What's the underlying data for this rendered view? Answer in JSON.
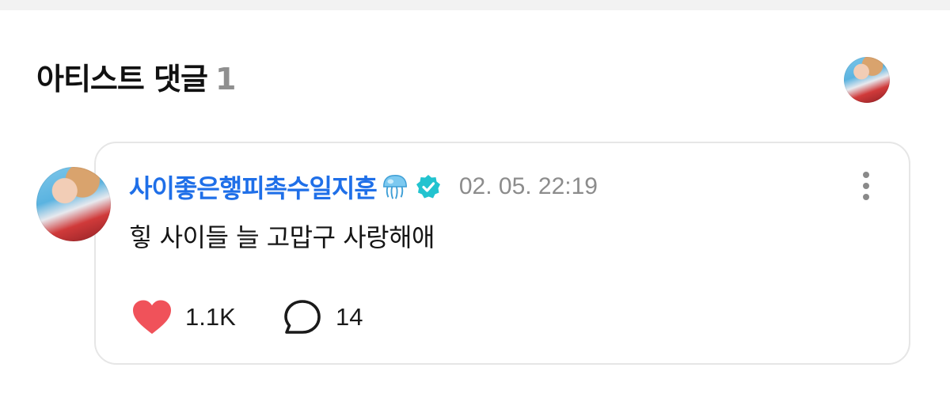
{
  "header": {
    "title": "아티스트 댓글",
    "count": "1",
    "avatar_icon": "artist-avatar"
  },
  "comment": {
    "author": "사이좋은햏피촉수일지훈",
    "author_emoji": "jellyfish-emoji",
    "verified_icon": "verified-badge-icon",
    "timestamp": "02. 05. 22:19",
    "text": "힣 사이들 늘 고맙구 사랑해애",
    "likes": "1.1K",
    "replies": "14",
    "more_icon": "more-vertical-icon"
  },
  "colors": {
    "author": "#1f6fe8",
    "verified": "#22c3cf",
    "heart": "#f0525a",
    "count_gray": "#8f8f8f"
  }
}
